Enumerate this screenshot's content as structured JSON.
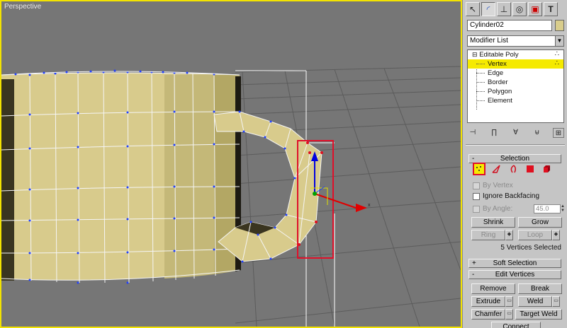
{
  "viewport": {
    "label": "Perspective"
  },
  "panel": {
    "tabs": [
      {
        "name": "create-tab",
        "icon": "arrow-cursor-icon"
      },
      {
        "name": "modify-tab",
        "icon": "bend-curve-icon"
      },
      {
        "name": "hierarchy-tab",
        "icon": "hierarchy-icon"
      },
      {
        "name": "motion-tab",
        "icon": "motion-circle-icon"
      },
      {
        "name": "display-tab",
        "icon": "monitor-icon"
      },
      {
        "name": "utilities-tab",
        "icon": "hammer-icon"
      }
    ],
    "object_name": "Cylinder02",
    "object_color": "#d9cd8c",
    "modifier_list": "Modifier List",
    "stack": {
      "root": "Editable Poly",
      "subobjects": [
        "Vertex",
        "Edge",
        "Border",
        "Polygon",
        "Element"
      ],
      "selected_index": 0
    },
    "selection": {
      "title": "Selection",
      "by_vertex": "By Vertex",
      "ignore_backfacing": "Ignore Backfacing",
      "by_angle": "By Angle:",
      "angle_value": "45.0",
      "shrink": "Shrink",
      "grow": "Grow",
      "ring": "Ring",
      "loop": "Loop",
      "status": "5 Vertices Selected"
    },
    "soft_selection": {
      "title": "Soft Selection",
      "sign": "+"
    },
    "edit_vertices": {
      "title": "Edit Vertices",
      "sign": "-",
      "remove": "Remove",
      "break": "Break",
      "extrude": "Extrude",
      "weld": "Weld",
      "chamfer": "Chamfer",
      "target_weld": "Target Weld",
      "connect": "Connect"
    },
    "selection_sign": "-",
    "colors": {
      "active_border": "#f3e300",
      "selection_highlight": "#f5ea00",
      "mug_fill": "#d8cb8c",
      "gizmo_x": "#e00000",
      "gizmo_y": "#0000e0",
      "gizmo_z": "#00a000"
    }
  }
}
